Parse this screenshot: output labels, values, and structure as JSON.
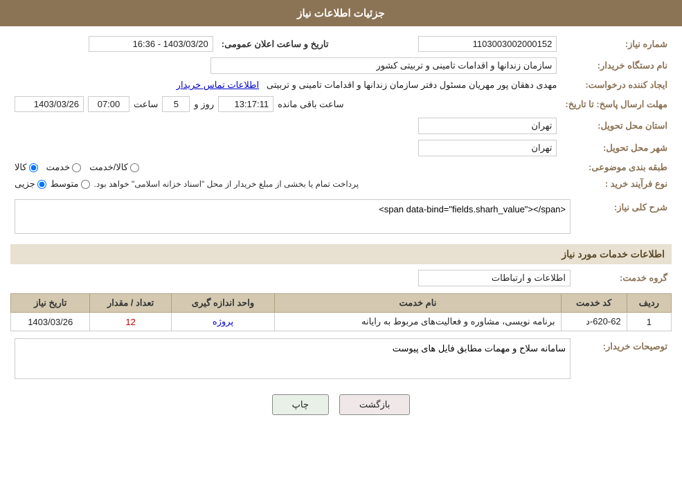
{
  "header": {
    "title": "جزئیات اطلاعات نیاز"
  },
  "fields": {
    "shomare_niaz_label": "شماره نیاز:",
    "shomare_niaz_value": "1103003002000152",
    "nam_dastgah_label": "نام دستگاه خریدار:",
    "nam_dastgah_value": "سازمان زندانها و اقدامات تامینی و تربیتی کشور",
    "ijad_label": "ایجاد کننده درخواست:",
    "ijad_value": "مهدی  دهقان پور مهریان مسئول دفتر سازمان زندانها و اقدامات تامینی و تربیتی",
    "ijad_link": "اطلاعات تماس خریدار",
    "mohlat_label": "مهلت ارسال پاسخ: تا تاریخ:",
    "mohlat_date": "1403/03/26",
    "mohlat_saat_label": "ساعت",
    "mohlat_saat": "07:00",
    "mohlat_roz_label": "روز و",
    "mohlat_roz": "5",
    "mohlat_saat2": "13:17:11",
    "mohlat_bagi": "ساعت باقی مانده",
    "ostan_label": "استان محل تحویل:",
    "ostan_value": "تهران",
    "shahr_label": "شهر محل تحویل:",
    "shahr_value": "تهران",
    "tabagheh_label": "طبقه بندی موضوعی:",
    "tabagheh_kala": "کالا",
    "tabagheh_khedmat": "خدمت",
    "tabagheh_kala_khedmat": "کالا/خدمت",
    "noefrayand_label": "نوع فرآیند خرید :",
    "noefrayand_jozyi": "جزیی",
    "noefrayand_motevaset": "متوسط",
    "noefrayand_desc": "پرداخت تمام یا بخشی از مبلغ خریدار از محل \"اسناد خزانه اسلامی\" خواهد بود.",
    "sharh_label": "شرح کلی نیاز:",
    "sharh_value": "سامانه سلاح و مهمات مطابق فایل های پیوست",
    "services_section": "اطلاعات خدمات مورد نیاز",
    "grooh_label": "گروه خدمت:",
    "grooh_value": "اطلاعات و ارتباطات",
    "table": {
      "headers": [
        "ردیف",
        "کد خدمت",
        "نام خدمت",
        "واحد اندازه گیری",
        "تعداد / مقدار",
        "تاریخ نیاز"
      ],
      "rows": [
        {
          "radif": "1",
          "kod": "620-62-د",
          "naam": "برنامه نویسی، مشاوره و فعالیت‌های مربوط به رایانه",
          "vahed": "پروژه",
          "tedad": "12",
          "tarikh": "1403/03/26"
        }
      ]
    },
    "tosih_label": "توصیحات خریدار:",
    "tosih_value": "سامانه سلاح و مهمات مطابق فایل های پیوست",
    "tarikhe_elaan_label": "تاریخ و ساعت اعلان عمومی:",
    "tarikhe_elaan_value": "1403/03/20 - 16:36"
  },
  "buttons": {
    "print": "چاپ",
    "back": "بازگشت"
  }
}
